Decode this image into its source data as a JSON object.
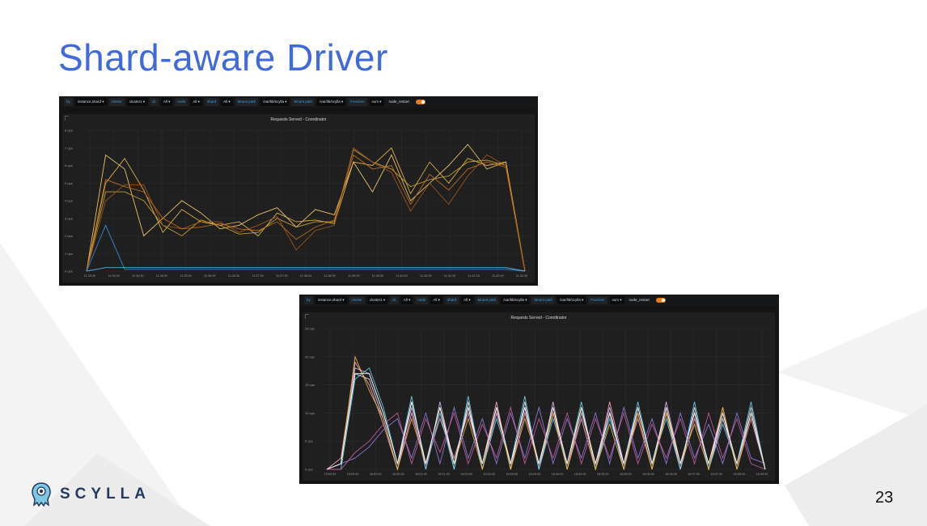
{
  "slide": {
    "title": "Shard-aware Driver",
    "page_number": "23",
    "logo_text": "SCYLLA",
    "colors": {
      "title": "#4169d8",
      "logo": "#243a5e",
      "toggle": "#eb7b18"
    }
  },
  "panel1": {
    "toolbar": [
      {
        "label": "by",
        "value": "instance,shard ▾"
      },
      {
        "label": "cluster",
        "value": "cluster1 ▾"
      },
      {
        "label": "dc",
        "value": "All ▾"
      },
      {
        "label": "node",
        "value": "All ▾"
      },
      {
        "label": "shard",
        "value": "All ▾"
      },
      {
        "label": "Mount path",
        "value": "/var/lib/scylla ▾"
      },
      {
        "label": "Mount path",
        "value": "/var/lib/scylla ▾"
      },
      {
        "label": "Function",
        "value": "sum ▾"
      }
    ],
    "toggle_label": "node_restart"
  },
  "panel2": {
    "toolbar": [
      {
        "label": "by",
        "value": "instance,shard ▾"
      },
      {
        "label": "cluster",
        "value": "cluster1 ▾"
      },
      {
        "label": "dc",
        "value": "All ▾"
      },
      {
        "label": "node",
        "value": "All ▾"
      },
      {
        "label": "shard",
        "value": "All ▾"
      },
      {
        "label": "Mount path",
        "value": "/var/lib/scylla ▾"
      },
      {
        "label": "Mount path",
        "value": "/var/lib/scylla ▾"
      },
      {
        "label": "Function",
        "value": "sum ▾"
      }
    ],
    "toggle_label": "node_restart"
  },
  "chart_data": [
    {
      "type": "line",
      "title": "Requests Served - Coordinator",
      "yticks": [
        "0 ops",
        "1 ops",
        "2 ops",
        "3 ops",
        "4 ops",
        "5 ops",
        "6 ops",
        "7 ops",
        "8 ops"
      ],
      "ylim": [
        0,
        8
      ],
      "xticks": [
        "11:33:30",
        "11:34:00",
        "11:34:30",
        "11:35:00",
        "11:35:30",
        "11:36:00",
        "11:36:30",
        "11:37:00",
        "11:37:30",
        "11:38:00",
        "11:38:30",
        "11:39:00",
        "11:39:30",
        "11:40:00",
        "11:40:30",
        "11:41:00",
        "11:41:30",
        "11:42:00",
        "11:42:30"
      ],
      "grid": true,
      "series": [
        {
          "color": "#f2c96d",
          "values": [
            0,
            6.6,
            5.8,
            2.0,
            3.0,
            4.0,
            3.3,
            2.4,
            2.6,
            3.2,
            3.6,
            2.5,
            3.5,
            3.2,
            6.2,
            4.5,
            6.6,
            4.0,
            5.0,
            6.0,
            7.2,
            5.8,
            6.2,
            0
          ]
        },
        {
          "color": "#e0b44f",
          "values": [
            0,
            5.0,
            6.4,
            4.6,
            2.2,
            3.5,
            2.8,
            2.6,
            2.8,
            2.0,
            3.3,
            2.8,
            2.9,
            2.7,
            6.2,
            6.0,
            7.0,
            4.4,
            6.2,
            5.0,
            6.4,
            6.0,
            6.2,
            0
          ]
        },
        {
          "color": "#c8a233",
          "values": [
            0,
            4.5,
            4.5,
            4.0,
            2.6,
            2.0,
            2.9,
            2.6,
            2.1,
            2.2,
            3.0,
            2.5,
            2.8,
            2.8,
            6.9,
            6.2,
            5.8,
            4.8,
            5.2,
            5.4,
            6.2,
            6.3,
            6.0,
            0
          ]
        },
        {
          "color": "#a0561c",
          "values": [
            0,
            4.0,
            4.9,
            4.9,
            2.6,
            2.4,
            2.8,
            2.8,
            2.2,
            2.6,
            3.1,
            1.2,
            2.3,
            2.6,
            7.0,
            6.2,
            5.6,
            3.4,
            5.0,
            3.8,
            5.4,
            6.6,
            6.0,
            0
          ]
        },
        {
          "color": "#c36d1a",
          "values": [
            0,
            5.2,
            4.8,
            4.5,
            3.0,
            2.4,
            2.5,
            2.7,
            2.4,
            2.3,
            2.8,
            1.8,
            2.5,
            2.9,
            6.6,
            5.8,
            6.0,
            3.8,
            5.5,
            4.6,
            5.8,
            6.2,
            5.9,
            0
          ]
        },
        {
          "color": "#3b8fd6",
          "values": [
            0,
            2.6,
            0.1,
            0.1,
            0.1,
            0.1,
            0.1,
            0.1,
            0.1,
            0.1,
            0.1,
            0.1,
            0.1,
            0.1,
            0.1,
            0.1,
            0.1,
            0.1,
            0.1,
            0.1,
            0.1,
            0.1,
            0.1,
            0
          ]
        },
        {
          "color": "#5bb6f0",
          "values": [
            0,
            0.2,
            0.2,
            0.2,
            0.2,
            0.2,
            0.2,
            0.2,
            0.2,
            0.2,
            0.2,
            0.2,
            0.2,
            0.2,
            0.2,
            0.2,
            0.2,
            0.2,
            0.2,
            0.2,
            0.2,
            0.2,
            0.2,
            0
          ]
        }
      ]
    },
    {
      "type": "line",
      "title": "Requests Served - Coordinator",
      "yticks": [
        "0 ops",
        "5 ops",
        "10 ops",
        "15 ops",
        "20 ops",
        "25 ops"
      ],
      "ylim": [
        0,
        25
      ],
      "xticks": [
        "15:59:00",
        "15:59:30",
        "16:00:00",
        "16:00:30",
        "16:01:00",
        "16:01:30",
        "16:02:00",
        "16:02:30",
        "16:03:00",
        "16:03:30",
        "16:04:00",
        "16:04:30",
        "16:05:00",
        "16:05:30",
        "16:06:00",
        "16:06:30",
        "16:07:00",
        "16:07:30",
        "16:08:00",
        "16:08:30"
      ],
      "grid": true,
      "series": [
        {
          "color": "#f0e6f5",
          "values": [
            0,
            1,
            17,
            16,
            9,
            0,
            12,
            1,
            11,
            0,
            12,
            0,
            11,
            0,
            12,
            0,
            10,
            1,
            11,
            0,
            10,
            0,
            11,
            1,
            10,
            0,
            11,
            0,
            9,
            1,
            11,
            0
          ]
        },
        {
          "color": "#d8b4e8",
          "values": [
            0,
            1,
            18,
            17,
            10,
            1,
            11,
            0,
            12,
            1,
            11,
            0,
            10,
            1,
            11,
            0,
            12,
            0,
            10,
            1,
            11,
            0,
            10,
            0,
            12,
            1,
            10,
            0,
            10,
            0,
            10,
            0
          ]
        },
        {
          "color": "#f7a6c7",
          "values": [
            0,
            2,
            19,
            15,
            8,
            0,
            10,
            1,
            9,
            2,
            10,
            1,
            12,
            0,
            10,
            1,
            11,
            0,
            9,
            0,
            12,
            1,
            9,
            0,
            11,
            0,
            9,
            1,
            11,
            0,
            9,
            0
          ]
        },
        {
          "color": "#6bd0e8",
          "values": [
            0,
            0,
            16,
            18,
            11,
            1,
            13,
            0,
            10,
            0,
            13,
            0,
            9,
            1,
            13,
            0,
            9,
            1,
            12,
            0,
            9,
            1,
            12,
            1,
            9,
            0,
            12,
            0,
            8,
            1,
            12,
            0
          ]
        },
        {
          "color": "#e9b641",
          "values": [
            0,
            1,
            20,
            14,
            9,
            0,
            9,
            1,
            11,
            1,
            9,
            0,
            11,
            0,
            9,
            1,
            10,
            0,
            11,
            0,
            8,
            0,
            10,
            0,
            10,
            1,
            8,
            0,
            11,
            0,
            10,
            0
          ]
        },
        {
          "color": "#8c7dd9",
          "values": [
            0,
            1,
            2,
            4,
            7,
            9,
            2,
            10,
            1,
            11,
            2,
            9,
            1,
            10,
            2,
            11,
            1,
            9,
            2,
            10,
            1,
            11,
            2,
            9,
            1,
            10,
            2,
            8,
            1,
            10,
            2,
            1
          ]
        },
        {
          "color": "#c65b9a",
          "values": [
            0,
            0,
            3,
            5,
            8,
            10,
            1,
            9,
            3,
            10,
            1,
            8,
            2,
            11,
            1,
            9,
            2,
            10,
            1,
            9,
            2,
            10,
            1,
            8,
            2,
            9,
            1,
            10,
            2,
            9,
            1,
            0
          ]
        },
        {
          "color": "#ffffff",
          "values": [
            0,
            1,
            17,
            17,
            10,
            1,
            12,
            1,
            11,
            1,
            11,
            1,
            11,
            1,
            11,
            1,
            11,
            1,
            11,
            1,
            10,
            1,
            11,
            1,
            11,
            1,
            10,
            1,
            10,
            1,
            10,
            0
          ]
        }
      ]
    }
  ]
}
